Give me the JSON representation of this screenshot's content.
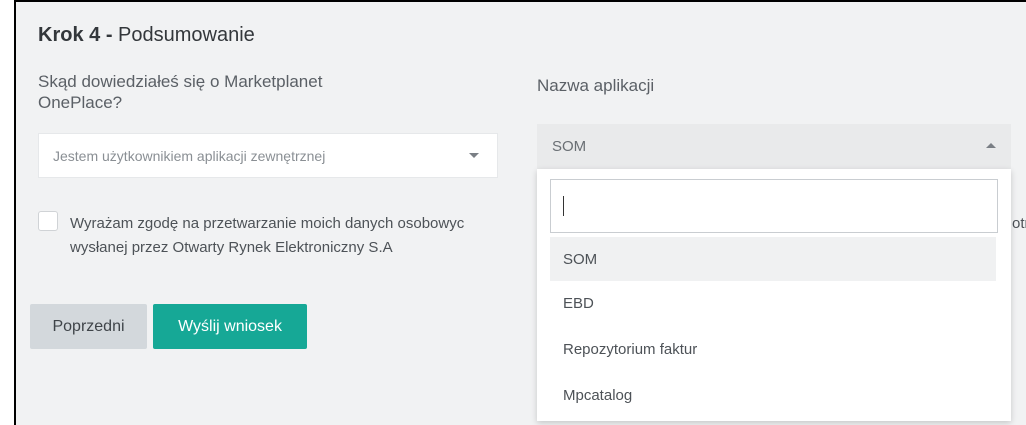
{
  "step": {
    "label": "Krok 4",
    "separator": "-",
    "title": "Podsumowanie"
  },
  "form": {
    "source_label": "Skąd dowiedziałeś się o Marketplanet OnePlace?",
    "source_value": "Jestem użytkownikiem aplikacji zewnętrznej",
    "app_label": "Nazwa aplikacji",
    "app_value": "SOM",
    "consent_line1": "Wyrażam zgodę na przetwarzanie moich danych osobowyc",
    "consent_line1_tail": "otrz",
    "consent_line2": "wysłanej przez Otwarty Rynek Elektroniczny S.A"
  },
  "buttons": {
    "prev": "Poprzedni",
    "send": "Wyślij wniosek"
  },
  "dropdown": {
    "search_value": "",
    "items": [
      "SOM",
      "EBD",
      "Repozytorium faktur",
      "Mpcatalog"
    ],
    "active_index": 0
  },
  "colors": {
    "accent": "#16a896",
    "panel": "#f1f2f3"
  }
}
